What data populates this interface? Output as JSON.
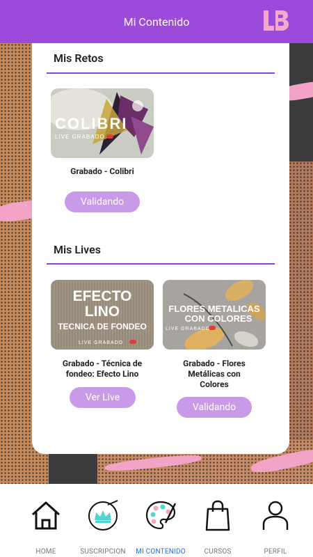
{
  "header": {
    "title": "Mi Contenido",
    "logo_text": "LB"
  },
  "retos": {
    "title": "Mis Retos",
    "items": [
      {
        "thumb_title": "COLIBRI",
        "thumb_sub": "LIVE GRABADO",
        "title": "Grabado - Colibri",
        "button": "Validando"
      }
    ]
  },
  "lives": {
    "title": "Mis Lives",
    "items": [
      {
        "thumb_title_1": "EFECTO",
        "thumb_title_2": "LINO",
        "thumb_title_3": "TECNICA DE FONDEO",
        "thumb_sub": "LIVE GRABADO",
        "title_1": "Grabado - Técnica de",
        "title_2": "fondeo: Efecto Lino",
        "button": "Ver Live"
      },
      {
        "thumb_title_1": "FLORES METALICAS",
        "thumb_title_2": "CON COLORES",
        "thumb_sub": "LIVE GRABADO",
        "title_1": "Grabado - Flores",
        "title_2": "Metálicas con",
        "title_3": "Colores",
        "button": "Validando"
      }
    ]
  },
  "nav": [
    {
      "label": "HOME",
      "icon": "home-icon"
    },
    {
      "label": "SUSCRIPCION",
      "icon": "crown-icon"
    },
    {
      "label": "MI CONTENIDO",
      "icon": "palette-icon",
      "active": true
    },
    {
      "label": "CURSOS",
      "icon": "shopping-bag-icon"
    },
    {
      "label": "PERFIL",
      "icon": "user-icon"
    }
  ],
  "colors": {
    "header": "#9b4ad9",
    "pill": "#c89ae8",
    "active_nav": "#2a6fdb"
  }
}
